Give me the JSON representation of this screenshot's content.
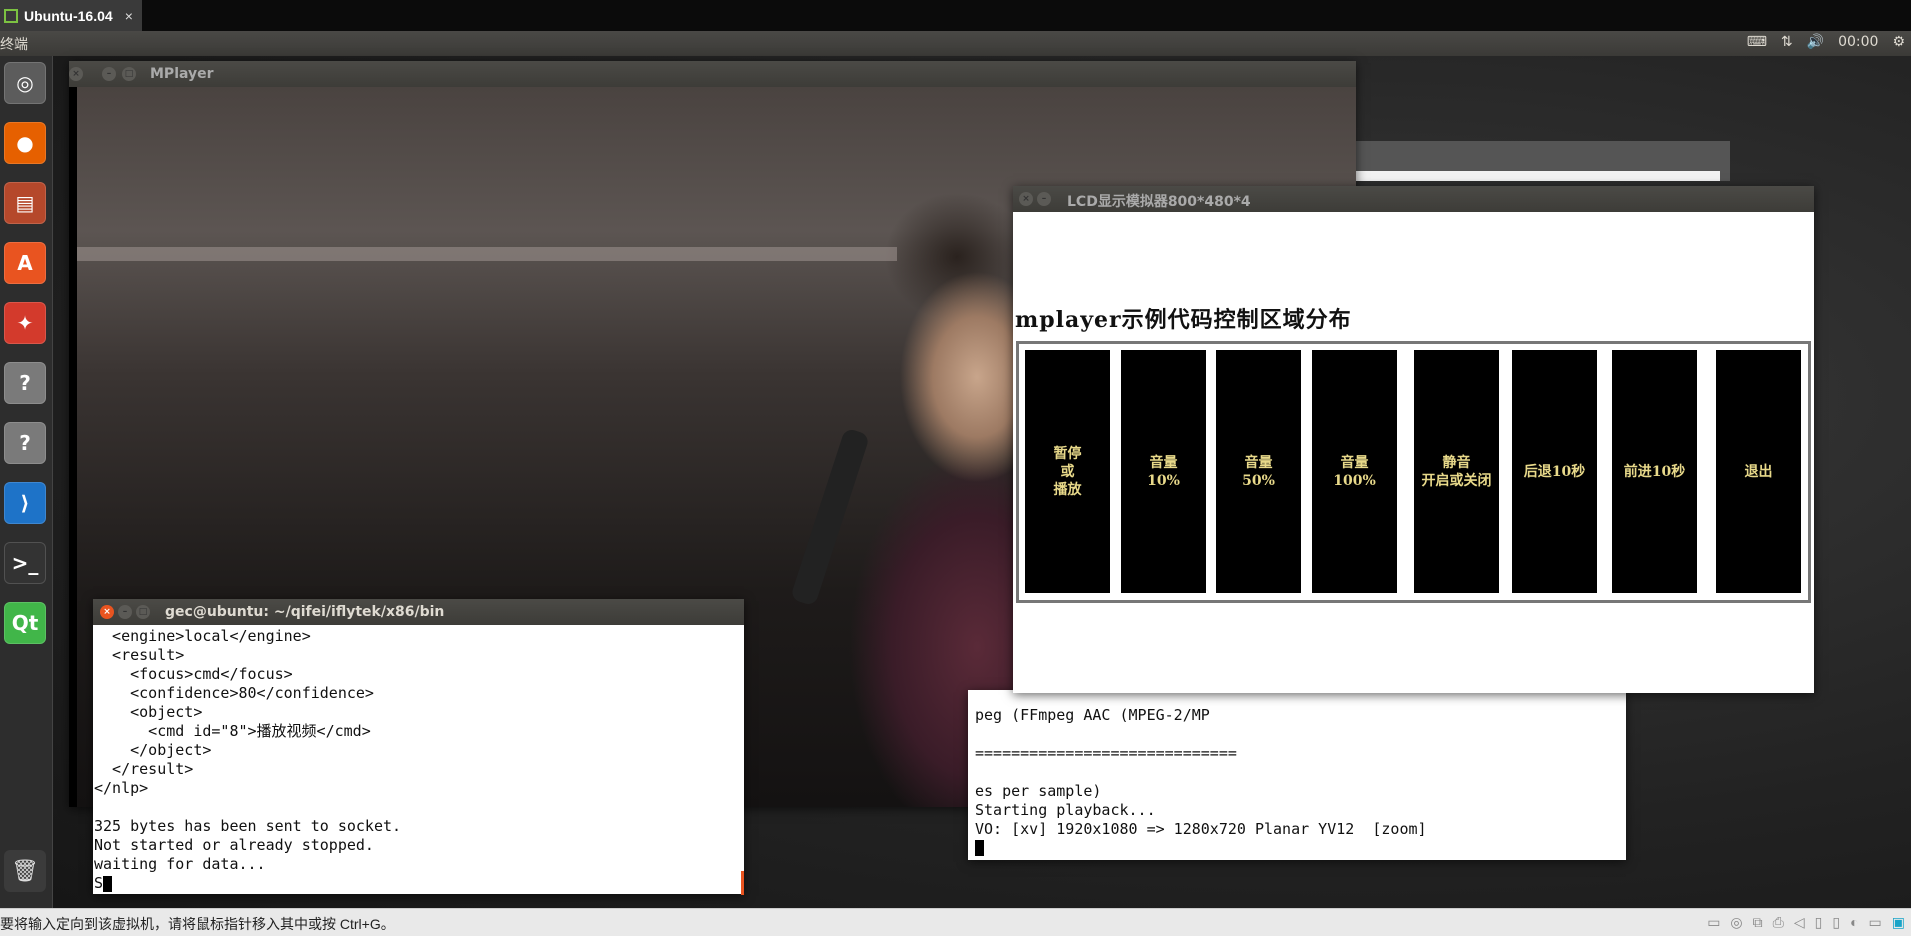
{
  "host": {
    "tab_label": "Ubuntu-16.04",
    "tab_close": "×",
    "status_message": "要将输入定向到该虚拟机，请将鼠标指针移入其中或按 Ctrl+G。"
  },
  "panel": {
    "app_title": "终端",
    "clock": "00:00"
  },
  "launcher": {
    "items": [
      {
        "name": "ubuntu-dash-icon",
        "glyph": "◎",
        "color": "#5c5c5c"
      },
      {
        "name": "firefox-icon",
        "glyph": "●",
        "color": "#e66000"
      },
      {
        "name": "files-icon",
        "glyph": "▤",
        "color": "#b5482b"
      },
      {
        "name": "software-center-icon",
        "glyph": "A",
        "color": "#e95420"
      },
      {
        "name": "system-settings-icon",
        "glyph": "✦",
        "color": "#d33a2c"
      },
      {
        "name": "unknown-app-icon",
        "glyph": "?",
        "color": "#7a7a7a"
      },
      {
        "name": "unknown-app-icon-2",
        "glyph": "?",
        "color": "#7a7a7a"
      },
      {
        "name": "vscode-icon",
        "glyph": "⟩",
        "color": "#1e73c8"
      },
      {
        "name": "terminal-icon",
        "glyph": ">_",
        "color": "#333333"
      },
      {
        "name": "qt-creator-icon",
        "glyph": "Qt",
        "color": "#41b649"
      }
    ],
    "trash_glyph": "🗑"
  },
  "mplayer": {
    "title": "MPlayer"
  },
  "lcd": {
    "title": "LCD显示模拟器800*480*4",
    "heading": "mplayer示例代码控制区域分布",
    "buttons": [
      "暂停\n或\n播放",
      "音量\n10%",
      "音量\n50%",
      "音量\n100%",
      "静音\n开启或关闭",
      "后退10秒",
      "前进10秒",
      "退出"
    ]
  },
  "mplayer_terminal": {
    "lines": [
      "peg (FFmpeg AAC (MPEG-2/MP",
      "",
      "=============================",
      "",
      "es per sample)",
      "Starting playback...",
      "VO: [xv] 1920x1080 => 1280x720 Planar YV12  [zoom]"
    ]
  },
  "gec_terminal": {
    "title": "gec@ubuntu: ~/qifei/iflytek/x86/bin",
    "lines": [
      "  <engine>local</engine>",
      "  <result>",
      "    <focus>cmd</focus>",
      "    <confidence>80</confidence>",
      "    <object>",
      "      <cmd id=\"8\">播放视频</cmd>",
      "    </object>",
      "  </result>",
      "</nlp>",
      "",
      "325 bytes has been sent to socket.",
      "Not started or already stopped.",
      "waiting for data...",
      "S"
    ]
  }
}
